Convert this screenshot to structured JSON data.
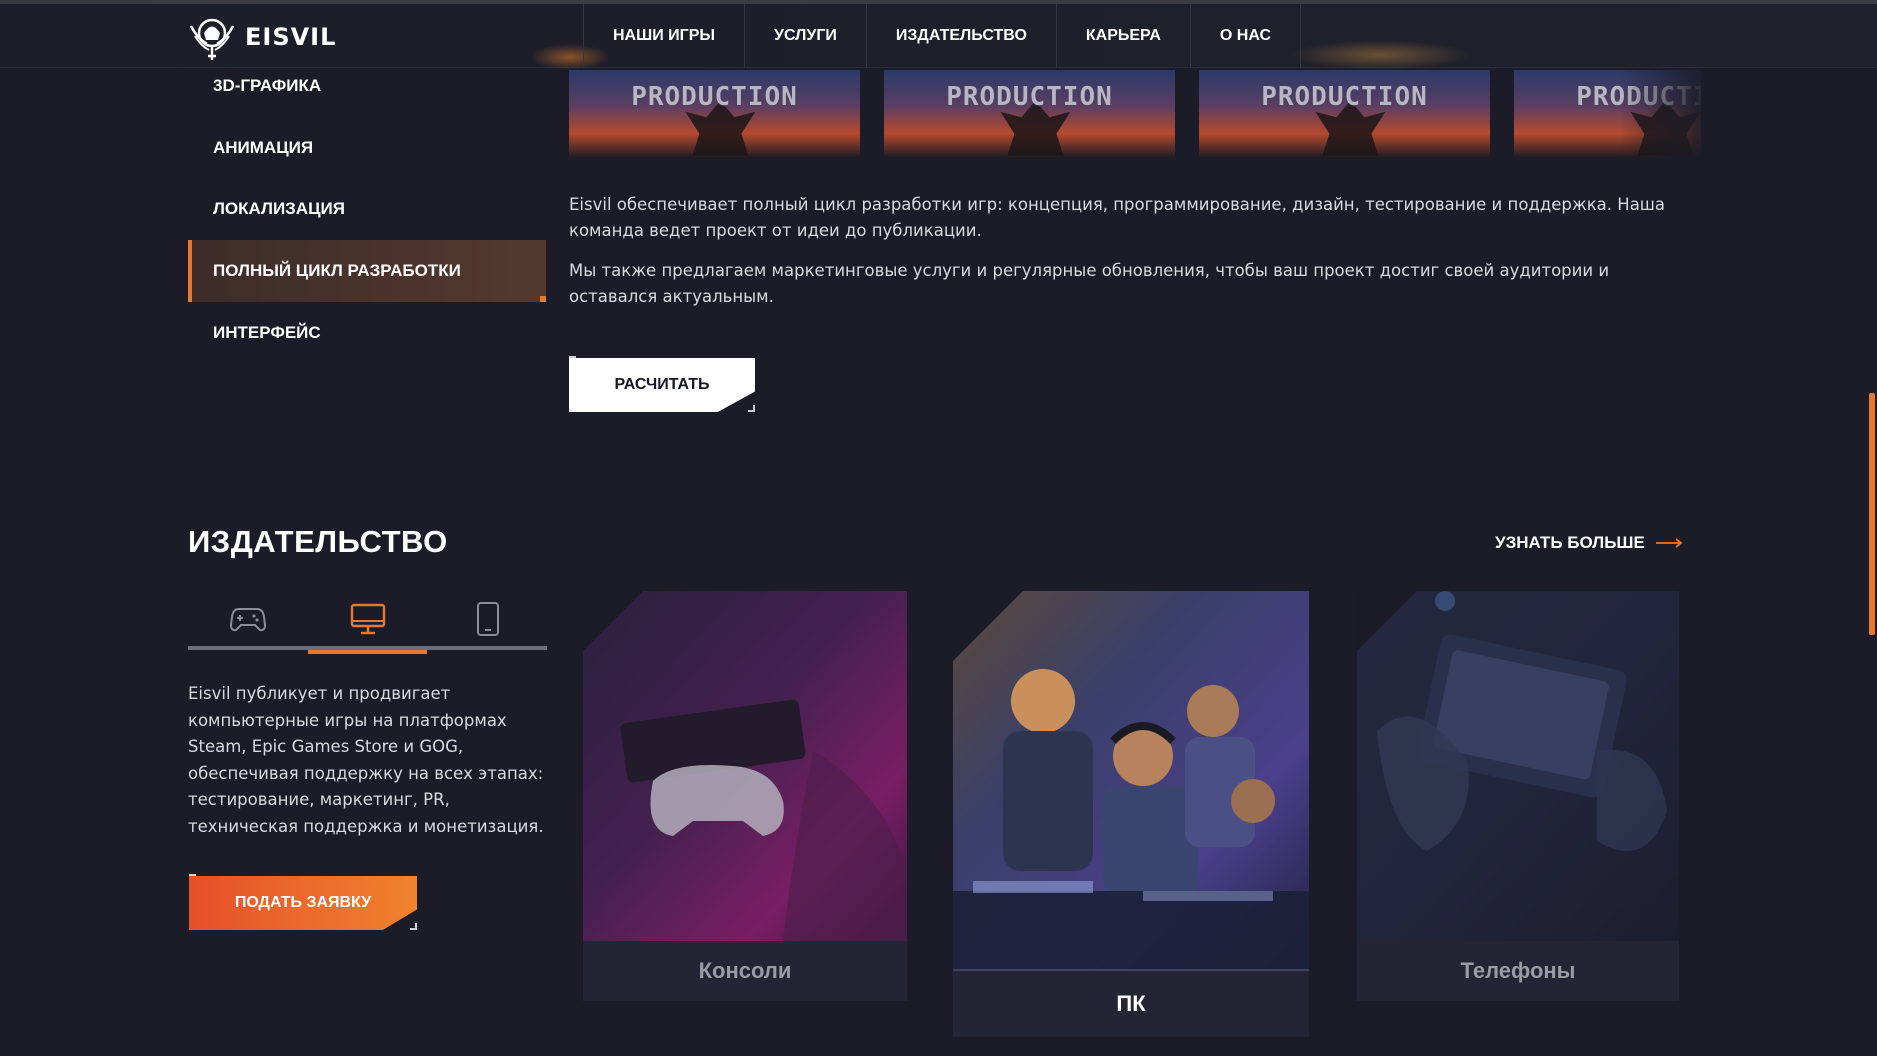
{
  "brand": {
    "name": "EISVIL"
  },
  "nav": [
    {
      "label": "НАШИ ИГРЫ"
    },
    {
      "label": "УСЛУГИ"
    },
    {
      "label": "ИЗДАТЕЛЬСТВО"
    },
    {
      "label": "КАРЬЕРА"
    },
    {
      "label": "О НАС"
    }
  ],
  "services": {
    "items": [
      {
        "label": "3D-ГРАФИКА"
      },
      {
        "label": "АНИМАЦИЯ"
      },
      {
        "label": "ЛОКАЛИЗАЦИЯ"
      },
      {
        "label": "ПОЛНЫЙ ЦИКЛ РАЗРАБОТКИ",
        "active": true
      },
      {
        "label": "ИНТЕРФЕЙС"
      }
    ],
    "thumbnails": [
      "PRODUCTION",
      "PRODUCTION",
      "PRODUCTION",
      "PRODUCTION"
    ],
    "paragraphs": [
      "Eisvil обеспечивает полный цикл разработки игр: концепция, программирование, дизайн, тестирование и поддержка. Наша команда ведет проект от идеи до публикации.",
      "Мы также предлагаем маркетинговые услуги и регулярные обновления, чтобы ваш проект достиг своей аудитории и оставался актуальным."
    ],
    "calc_button": "РАСЧИТАТЬ"
  },
  "publishing": {
    "title": "ИЗДАТЕЛЬСТВО",
    "learn_more": "УЗНАТЬ БОЛЬШЕ",
    "tabs": [
      {
        "icon": "gamepad-icon",
        "active": false
      },
      {
        "icon": "monitor-icon",
        "active": true
      },
      {
        "icon": "phone-icon",
        "active": false
      }
    ],
    "text": "Eisvil публикует и продвигает компьютерные игры на платформах Steam, Epic Games Store и GOG, обеспечивая поддержку на всех этапах: тестирование, маркетинг, PR, техническая поддержка и монетизация.",
    "apply_button": "ПОДАТЬ ЗАЯВКУ",
    "cards": [
      {
        "label": "Консоли",
        "active": false
      },
      {
        "label": "ПК",
        "active": true
      },
      {
        "label": "Телефоны",
        "active": false
      }
    ]
  },
  "colors": {
    "accent": "#e8782d",
    "background": "#1b1c27",
    "card_label_bg": "#232534"
  }
}
